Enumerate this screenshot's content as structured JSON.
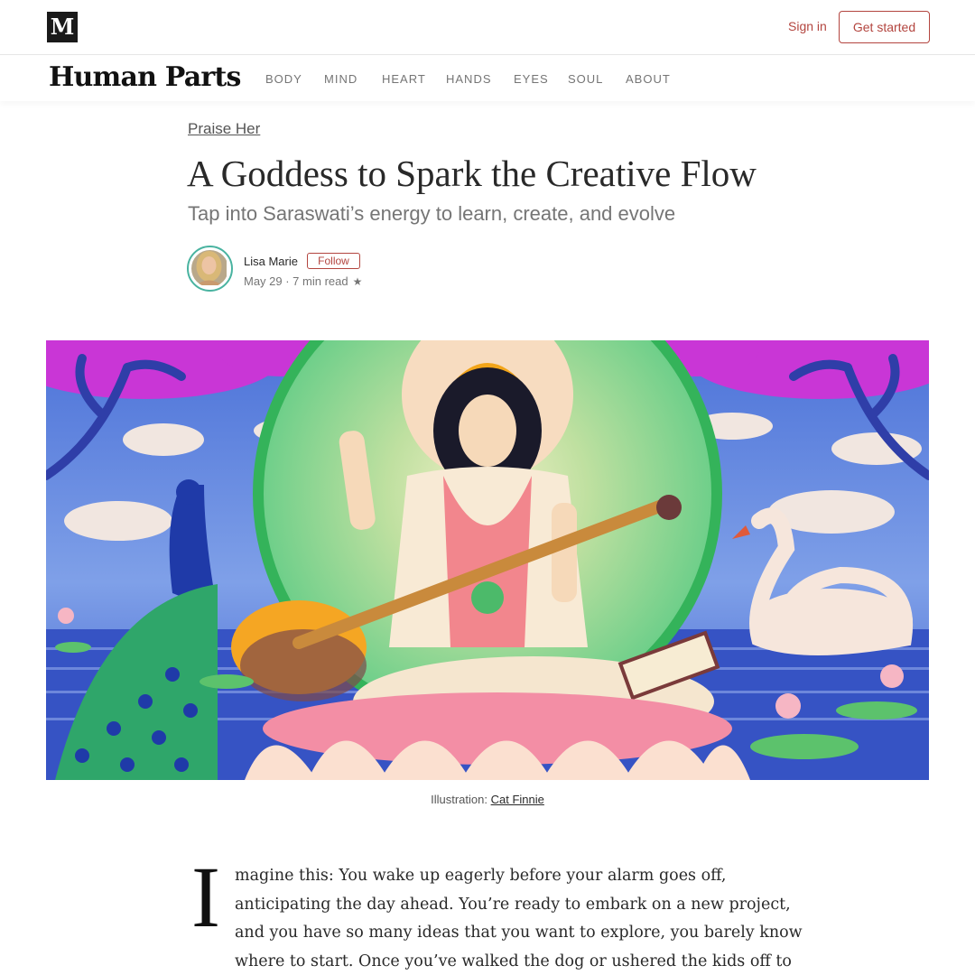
{
  "topbar": {
    "logo": "M",
    "sign_in": "Sign in",
    "get_started": "Get started",
    "accent_color": "#b3453f"
  },
  "publication": {
    "name": "Human Parts",
    "nav": [
      "BODY",
      "MIND",
      "HEART",
      "HANDS",
      "EYES",
      "SOUL",
      "ABOUT"
    ]
  },
  "article": {
    "kicker": "Praise Her",
    "title": "A Goddess to Spark the Creative Flow",
    "subtitle": "Tap into Saraswati’s energy to learn, create, and evolve",
    "author": "Lisa Marie",
    "follow_label": "Follow",
    "meta": "May 29 · 7 min read",
    "star": "★",
    "caption_prefix": "Illustration: ",
    "caption_credit": "Cat Finnie",
    "drop_cap": "I",
    "lines": [
      "magine this: You wake up eagerly before your alarm goes off,",
      "anticipating the day ahead. You’re ready to embark on a new project,",
      "and you have so many ideas that you want to explore, you barely know",
      "where to start. Once you’ve walked the dog or ushered the kids off to"
    ]
  },
  "icons": {
    "logo": "medium-logo-icon",
    "bookmark_star": "star-icon",
    "hero": "saraswati-illustration"
  }
}
